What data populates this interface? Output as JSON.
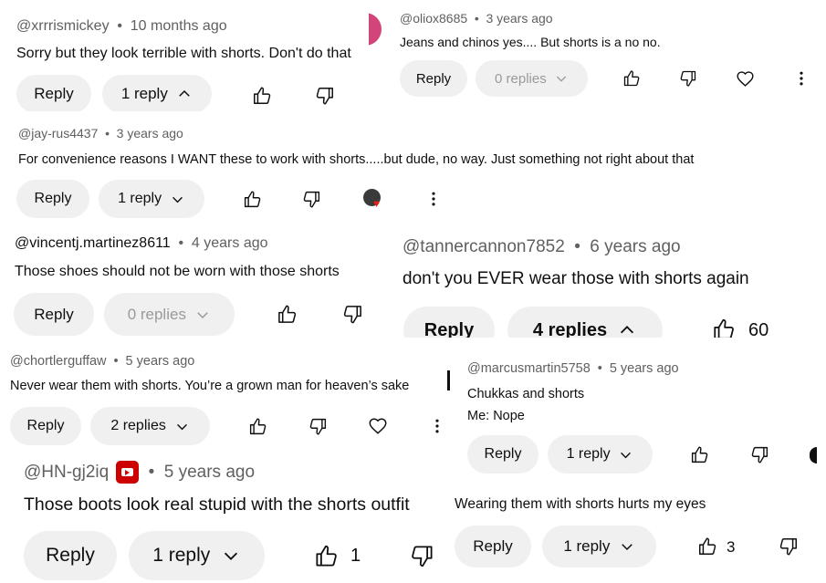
{
  "common": {
    "reply": "Reply",
    "dot": "•"
  },
  "comments": [
    {
      "author": "@xrrrismickey",
      "time": "10 months ago",
      "text": "Sorry but they look terrible with shorts. Don't do that",
      "replies": "1 reply"
    },
    {
      "author": "@oliox8685",
      "time": "3 years ago",
      "text": "Jeans  and chinos yes.... But shorts is a no no.",
      "replies": "0 replies"
    },
    {
      "author": "@jay-rus4437",
      "time": "3 years ago",
      "text": "For convenience reasons I WANT these to work with shorts.....but dude, no way. Just something not right about that",
      "replies": "1 reply"
    },
    {
      "author": "@vincentj.martinez8611",
      "time": "4 years ago",
      "text": "Those shoes should not be worn with those shorts",
      "replies": "0 replies"
    },
    {
      "author": "@tannercannon7852",
      "time": "6 years ago",
      "text": "don't you EVER wear those with shorts again",
      "replies": "4 replies",
      "likes": "60"
    },
    {
      "author": "@chortlerguffaw",
      "time": "5 years ago",
      "text": "Never wear them with shorts. You’re a grown man for heaven’s sake",
      "replies": "2 replies"
    },
    {
      "author": "@marcusmartin5758",
      "time": "5 years ago",
      "text": "Chukkas and shorts",
      "text2": "Me: Nope",
      "replies": "1 reply"
    },
    {
      "author": "@HN-gj2iq",
      "time": "5 years ago",
      "text": "Those boots look real stupid with the shorts outfit",
      "replies": "1 reply",
      "likes": "1"
    },
    {
      "text": "Wearing them with shorts hurts my eyes",
      "likes": "3"
    }
  ],
  "icons": [
    "thumb-up-icon",
    "thumb-down-icon",
    "heart-icon",
    "more-vert-icon",
    "chevron-up-icon",
    "chevron-down-icon",
    "creator-heart-avatar-icon",
    "member-badge-icon"
  ],
  "colors": {
    "pill_bg": "#f0f0f0",
    "meta_text": "#606060",
    "heart_red": "#e62117",
    "badge_red": "#cc0000",
    "edge_pink": "#d1457a"
  }
}
